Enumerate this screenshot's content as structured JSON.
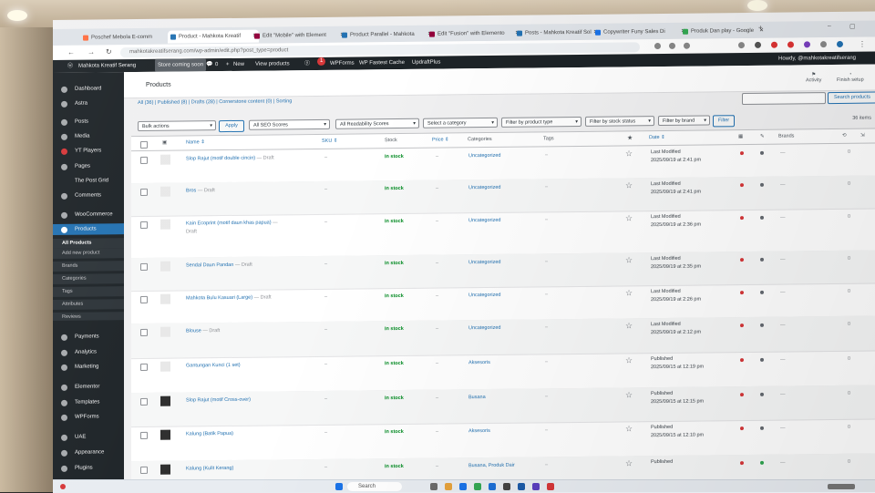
{
  "browser": {
    "tabs": [
      {
        "label": "Poschef Mebola E-comm"
      },
      {
        "label": "Product - Mahkota Kreatif"
      },
      {
        "label": "Edit \"Mobile\" with Element"
      },
      {
        "label": "Product Parallel - Mahkota"
      },
      {
        "label": "Edit \"Fusion\" with Elemento"
      },
      {
        "label": "Posts - Mahkota Kreatif Sol"
      },
      {
        "label": "Copywriter Funy Sales Di"
      },
      {
        "label": "Produk Dan play - Google"
      }
    ],
    "url": "mahkotakreatifserang.com/wp-admin/edit.php?post_type=product"
  },
  "adminbar": {
    "site_name": "Mahkota Kreatif Serang",
    "coming_soon": "Store coming soon",
    "comments": "0",
    "new": "New",
    "view_products": "View products",
    "updates": "1",
    "wpforms": "WPForms",
    "wp_fastest_cache": "WP Fastest Cache",
    "updraftplus": "UpdraftPlus",
    "howdy": "Howdy, @mahkotakreatifserang"
  },
  "sidebar": {
    "items": [
      {
        "label": "Dashboard"
      },
      {
        "label": "Astra"
      },
      {
        "label": "Posts"
      },
      {
        "label": "Media"
      },
      {
        "label": "YT Players"
      },
      {
        "label": "Pages"
      },
      {
        "label": "The Post Grid"
      },
      {
        "label": "Comments"
      },
      {
        "label": "WooCommerce"
      },
      {
        "label": "Products"
      },
      {
        "label": "Payments"
      },
      {
        "label": "Analytics"
      },
      {
        "label": "Marketing"
      },
      {
        "label": "Elementor"
      },
      {
        "label": "Templates"
      },
      {
        "label": "WPForms"
      },
      {
        "label": "UAE"
      },
      {
        "label": "Appearance"
      },
      {
        "label": "Plugins"
      }
    ],
    "submenu": [
      {
        "label": "All Products"
      },
      {
        "label": "Add new product"
      },
      {
        "label": "Brands"
      },
      {
        "label": "Categories"
      },
      {
        "label": "Tags"
      },
      {
        "label": "Attributes"
      },
      {
        "label": "Reviews"
      }
    ]
  },
  "header": {
    "title": "Products",
    "activity": "Activity",
    "finish_setup": "Finish setup"
  },
  "subsubsub": "All (36) | Published (8) | Drafts (28) | Cornerstone content (0) | Sorting",
  "search_button": "Search products",
  "filters": {
    "bulk_actions": "Bulk actions",
    "apply": "Apply",
    "seo_scores": "All SEO Scores",
    "readability": "All Readability Scores",
    "category": "Select a category",
    "product_type": "Filter by product type",
    "stock_status": "Filter by stock status",
    "brand": "Filter by brand",
    "filter": "Filter",
    "items_count": "36 items"
  },
  "columns": {
    "name": "Name ⇕",
    "sku": "SKU ⇕",
    "stock": "Stock",
    "price": "Price ⇕",
    "categories": "Categories",
    "tags": "Tags",
    "featured": "★",
    "date": "Date ⇕",
    "brands": "Brands"
  },
  "products": [
    {
      "name": "Slop Rajut (motif double cincin)",
      "suffix": " — Draft",
      "name2": "",
      "sku": "–",
      "stock": "In stock",
      "price": "–",
      "categories": "Uncategorized",
      "tags": "–",
      "date_status": "Last Modified",
      "date": "2025/09/19 at 2:41 pm",
      "seo": "#d63638",
      "read": "#646970",
      "thumb": false
    },
    {
      "name": "Bros",
      "suffix": " — Draft",
      "name2": "",
      "sku": "–",
      "stock": "In stock",
      "price": "–",
      "categories": "Uncategorized",
      "tags": "–",
      "date_status": "Last Modified",
      "date": "2025/09/19 at 2:41 pm",
      "seo": "#d63638",
      "read": "#646970",
      "thumb": false
    },
    {
      "name": "Kain Ecoprint (motif daun khas papua)",
      "suffix": " —",
      "name2": "Draft",
      "sku": "–",
      "stock": "In stock",
      "price": "–",
      "categories": "Uncategorized",
      "tags": "–",
      "date_status": "Last Modified",
      "date": "2025/09/19 at 2:36 pm",
      "seo": "#d63638",
      "read": "#646970",
      "thumb": false
    },
    {
      "name": "Sendal Daun Pandan",
      "suffix": " — Draft",
      "name2": "",
      "sku": "–",
      "stock": "In stock",
      "price": "–",
      "categories": "Uncategorized",
      "tags": "–",
      "date_status": "Last Modified",
      "date": "2025/09/19 at 2:35 pm",
      "seo": "#d63638",
      "read": "#646970",
      "thumb": false
    },
    {
      "name": "Mahkota Bulu Kasuari (Large)",
      "suffix": " — Draft",
      "name2": "",
      "sku": "–",
      "stock": "In stock",
      "price": "–",
      "categories": "Uncategorized",
      "tags": "–",
      "date_status": "Last Modified",
      "date": "2025/09/19 at 2:26 pm",
      "seo": "#d63638",
      "read": "#646970",
      "thumb": false
    },
    {
      "name": "Blouse",
      "suffix": " — Draft",
      "name2": "",
      "sku": "–",
      "stock": "In stock",
      "price": "–",
      "categories": "Uncategorized",
      "tags": "–",
      "date_status": "Last Modified",
      "date": "2025/09/19 at 2:12 pm",
      "seo": "#d63638",
      "read": "#646970",
      "thumb": false
    },
    {
      "name": "Gantungan Kunci (1 set)",
      "suffix": "",
      "name2": "",
      "sku": "–",
      "stock": "In stock",
      "price": "–",
      "categories": "Aksesoris",
      "tags": "–",
      "date_status": "Published",
      "date": "2025/09/15 at 12:19 pm",
      "seo": "#d63638",
      "read": "#646970",
      "thumb": false
    },
    {
      "name": "Slop Rajut (motif Cross-over)",
      "suffix": "",
      "name2": "",
      "sku": "–",
      "stock": "In stock",
      "price": "–",
      "categories": "Busana",
      "tags": "–",
      "date_status": "Published",
      "date": "2025/09/15 at 12:15 pm",
      "seo": "#d63638",
      "read": "#646970",
      "thumb": true
    },
    {
      "name": "Kalung (Batik Papua)",
      "suffix": "",
      "name2": "",
      "sku": "–",
      "stock": "In stock",
      "price": "–",
      "categories": "Aksesoris",
      "tags": "–",
      "date_status": "Published",
      "date": "2025/09/15 at 12:10 pm",
      "seo": "#d63638",
      "read": "#646970",
      "thumb": true
    },
    {
      "name": "Kalung (Kulit Kerang)",
      "suffix": "",
      "name2": "",
      "sku": "–",
      "stock": "In stock",
      "price": "–",
      "categories": "Busana, Produk Dair",
      "tags": "–",
      "date_status": "Published",
      "date": "",
      "seo": "#d63638",
      "read": "#2ea44f",
      "thumb": true
    }
  ],
  "taskbar": {
    "search": "Search"
  }
}
